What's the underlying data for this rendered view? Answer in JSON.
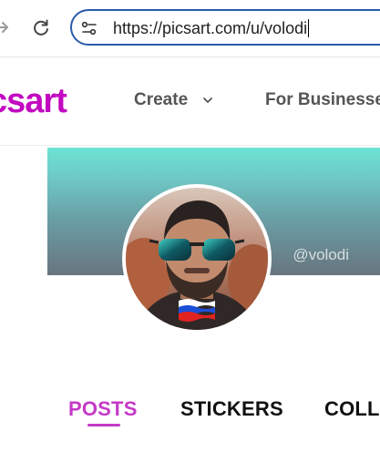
{
  "browser": {
    "url": "https://picsart.com/u/volodi",
    "forward_icon": "arrow-right-icon",
    "reload_icon": "reload-icon",
    "site_info_icon": "tune-icon"
  },
  "header": {
    "logo_text": "csart",
    "nav": [
      {
        "label": "Create",
        "has_dropdown": true
      },
      {
        "label": "For Businesses"
      }
    ],
    "brand_color": "#c209c1"
  },
  "profile": {
    "cover_handle": "@volodi",
    "avatar_badge": "russian-flag-icon"
  },
  "tabs": [
    {
      "label": "POSTS",
      "active": true
    },
    {
      "label": "STICKERS",
      "active": false
    },
    {
      "label": "COLL",
      "active": false
    }
  ],
  "colors": {
    "accent": "#c53ac7",
    "url_border": "#2a5aab"
  }
}
